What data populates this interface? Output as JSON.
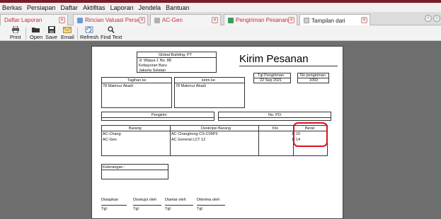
{
  "menu": [
    "Berkas",
    "Persiapan",
    "Daftar",
    "Aktifitas",
    "Laporan",
    "Jendela",
    "Bantuan"
  ],
  "tabs": [
    {
      "label": "Daftar Laporan",
      "color": "#c42d3a"
    },
    {
      "label": "Rincian Valuasi Persed",
      "color": "#c42d3a"
    },
    {
      "label": "AC-Gen",
      "color": "#c42d3a"
    },
    {
      "label": "Pengiriman Pesanan 1",
      "color": "#c42d3a"
    },
    {
      "label": "Tampilan dari",
      "color": "#222222"
    }
  ],
  "toolbar": {
    "print": "Print",
    "open": "Open",
    "save": "Save",
    "email": "Email",
    "refresh": "Refresh",
    "find": "Find Text"
  },
  "report": {
    "company_name": "Global Building, PT",
    "address": [
      "Jl. Wijaya 1 No. 88",
      "Kebayoran Baru",
      "Jakarta Selatan"
    ],
    "title": "Kirim Pesanan",
    "date_label": "Tgl Pengiriman",
    "date_value": "22 Sep 2021",
    "number_label": "No pengiriman",
    "number_value": "1002",
    "bill_to_label": "Tagihan ke",
    "bill_to_value": "78 Makmur Abadi",
    "ship_to_label": "kirim ke",
    "ship_to_value": "78 Makmur Abadi",
    "sender_label": "Pengirim",
    "po_label": "No. PO.",
    "columns": {
      "item": "Barang",
      "desc": "Deskripsi Barang",
      "qty": "Kts",
      "weight": "Berat"
    },
    "rows": [
      {
        "item": "AC-Chang",
        "desc": "AC Changhong CS-C09P3",
        "qty": "1",
        "weight": "10"
      },
      {
        "item": "AC-Gen",
        "desc": "AC General LCT 12",
        "qty": "1",
        "weight": "14"
      }
    ],
    "notes_label": "Keterangan :",
    "signatures": [
      {
        "label": "Disiapkan",
        "date": "Tgl:"
      },
      {
        "label": "Disetujui oleh",
        "date": "Tgl:"
      },
      {
        "label": "Diantar oleh",
        "date": "Tgl:"
      },
      {
        "label": "Diterima oleh",
        "date": "Tgl:"
      }
    ]
  },
  "highlight_color": "#d8121f"
}
